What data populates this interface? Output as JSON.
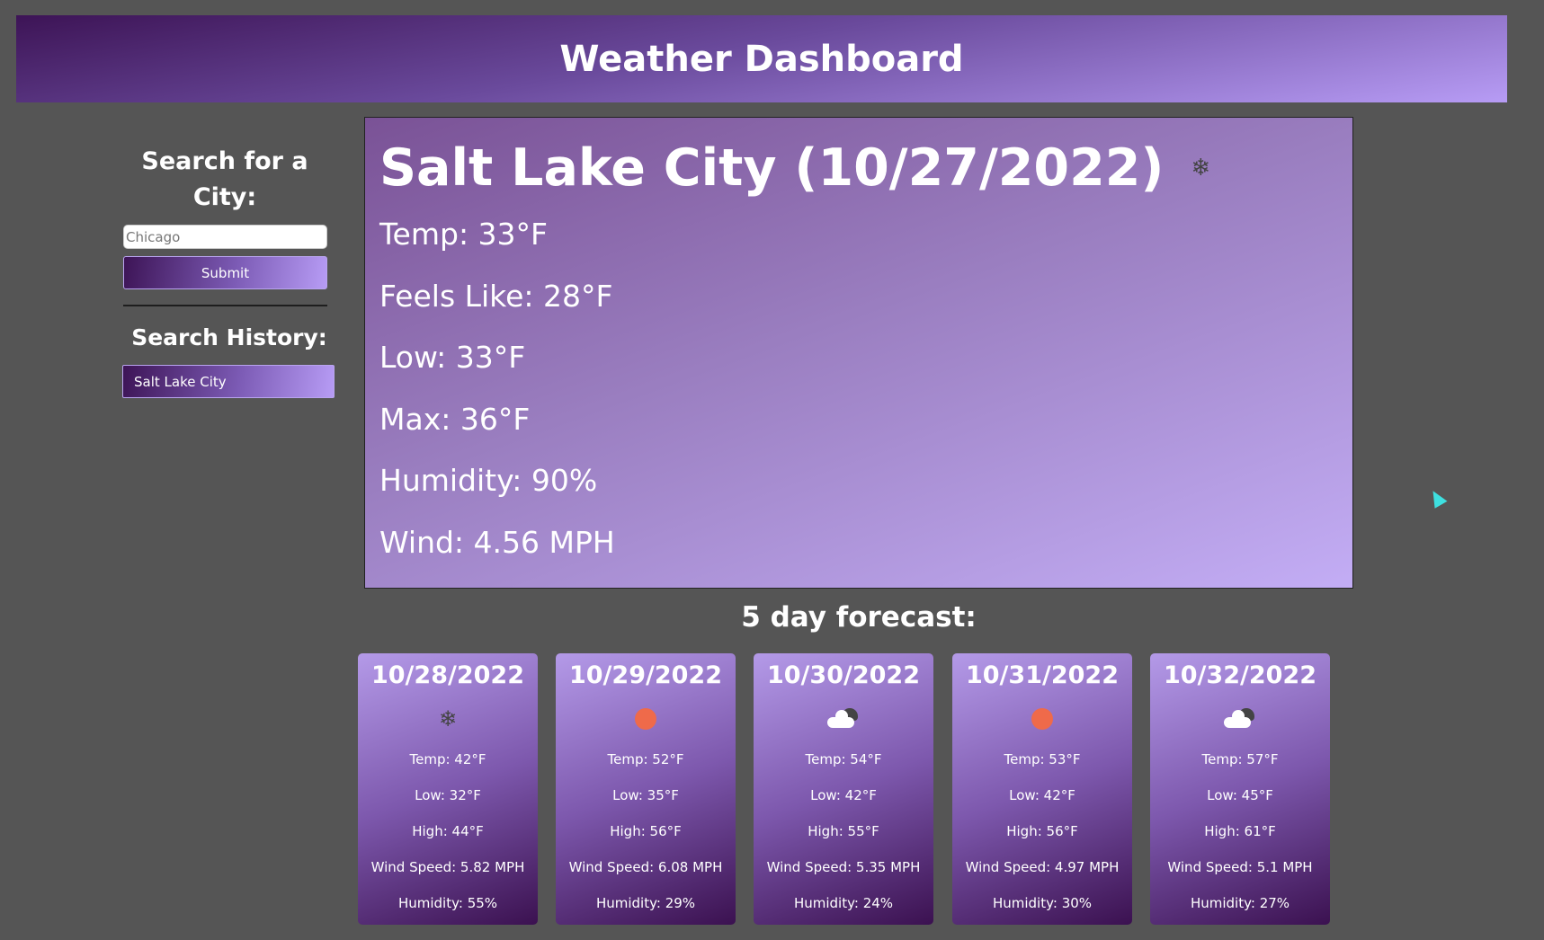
{
  "header": {
    "title": "Weather Dashboard"
  },
  "sidebar": {
    "search_title": "Search for a City:",
    "input_placeholder": "Chicago",
    "input_value": "",
    "submit_label": "Submit",
    "history_title": "Search History:",
    "history": [
      {
        "label": "Salt Lake City"
      }
    ]
  },
  "current": {
    "heading": "Salt Lake City (10/27/2022)",
    "icon": "snow-icon",
    "temp": "Temp: 33°F",
    "feels_like": "Feels Like: 28°F",
    "low": "Low: 33°F",
    "max": "Max: 36°F",
    "humidity": "Humidity: 90%",
    "wind": "Wind: 4.56 MPH"
  },
  "forecast": {
    "title": "5 day forecast:",
    "days": [
      {
        "date": "10/28/2022",
        "icon": "snow-icon",
        "temp": "Temp: 42°F",
        "low": "Low: 32°F",
        "high": "High: 44°F",
        "wind": "Wind Speed: 5.82 MPH",
        "humidity": "Humidity: 55%"
      },
      {
        "date": "10/29/2022",
        "icon": "sun-icon",
        "temp": "Temp: 52°F",
        "low": "Low: 35°F",
        "high": "High: 56°F",
        "wind": "Wind Speed: 6.08 MPH",
        "humidity": "Humidity: 29%"
      },
      {
        "date": "10/30/2022",
        "icon": "cloud-icon",
        "temp": "Temp: 54°F",
        "low": "Low: 42°F",
        "high": "High: 55°F",
        "wind": "Wind Speed: 5.35 MPH",
        "humidity": "Humidity: 24%"
      },
      {
        "date": "10/31/2022",
        "icon": "sun-icon",
        "temp": "Temp: 53°F",
        "low": "Low: 42°F",
        "high": "High: 56°F",
        "wind": "Wind Speed: 4.97 MPH",
        "humidity": "Humidity: 30%"
      },
      {
        "date": "10/32/2022",
        "icon": "cloud-icon",
        "temp": "Temp: 57°F",
        "low": "Low: 45°F",
        "high": "High: 61°F",
        "wind": "Wind Speed: 5.1 MPH",
        "humidity": "Humidity: 27%"
      }
    ]
  },
  "colors": {
    "page_background": "#555555",
    "accent_dark": "#3d1456",
    "accent_light": "#b79cf5",
    "sun": "#ef6a4a"
  }
}
